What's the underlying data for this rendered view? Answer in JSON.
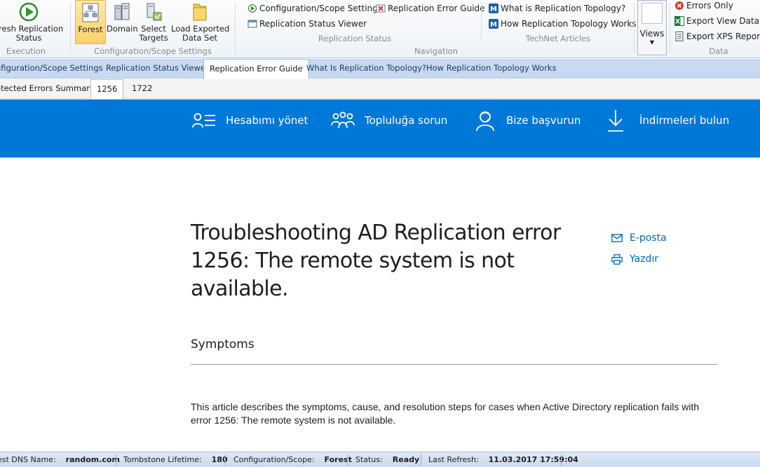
{
  "ribbon": {
    "execution": {
      "refresh_label_1": "fresh Replication",
      "refresh_label_2": "Status",
      "group_label": "Execution"
    },
    "config": {
      "forest_label": "Forest",
      "domain_label": "Domain",
      "select_targets_1": "Select",
      "select_targets_2": "Targets",
      "load_exported_1": "Load Exported",
      "load_exported_2": "Data Set",
      "group_label": "Configuration/Scope Settings"
    },
    "replication_status": {
      "config_scope": "Configuration/Scope Settings",
      "error_guide": "Replication Error Guide",
      "status_viewer": "Replication Status Viewer",
      "group_label": "Replication Status"
    },
    "navigation_label": "Navigation",
    "technet": {
      "what_is": "What is Replication Topology?",
      "how_works": "How Replication Topology Works",
      "group_label": "TechNet Articles"
    },
    "views_label": "Views",
    "data": {
      "errors_only": "Errors Only",
      "export_view": "Export View Data",
      "export_xps": "Export XPS Reports",
      "group_label": "Data"
    }
  },
  "tabs_primary": [
    "nfiguration/Scope Settings",
    "Replication Status Viewer",
    "Replication Error Guide",
    "What Is Replication Topology?",
    "How Replication Topology Works"
  ],
  "tabs_secondary": [
    "etected Errors Summary",
    "1256",
    "1722"
  ],
  "banner": {
    "manage_account": "Hesabımı yönet",
    "ask_community": "Topluluğa sorun",
    "contact_us": "Bize başvurun",
    "find_downloads": "İndirmeleri bulun"
  },
  "article": {
    "title": "Troubleshooting AD Replication error 1256: The remote system is not available.",
    "email_link": "E-posta",
    "print_link": "Yazdır",
    "section_heading": "Symptoms",
    "paragraph": "This article describes the symptoms, cause, and resolution steps for cases when Active Directory replication fails with error 1256: The remote system is not available."
  },
  "status_bar": {
    "dns_label": "est DNS Name:",
    "dns_value": "random.com",
    "tombstone_label": "Tombstone Lifetime:",
    "tombstone_value": "180",
    "scope_label": "Configuration/Scope:",
    "scope_value": "Forest",
    "status_label": "Status:",
    "status_value": "Ready",
    "refresh_label": "Last Refresh:",
    "refresh_value": "11.03.2017 17:59:04"
  },
  "colors": {
    "banner_blue": "#0078d7",
    "link_blue": "#0067b8",
    "selected_button": "#ffd26a"
  }
}
